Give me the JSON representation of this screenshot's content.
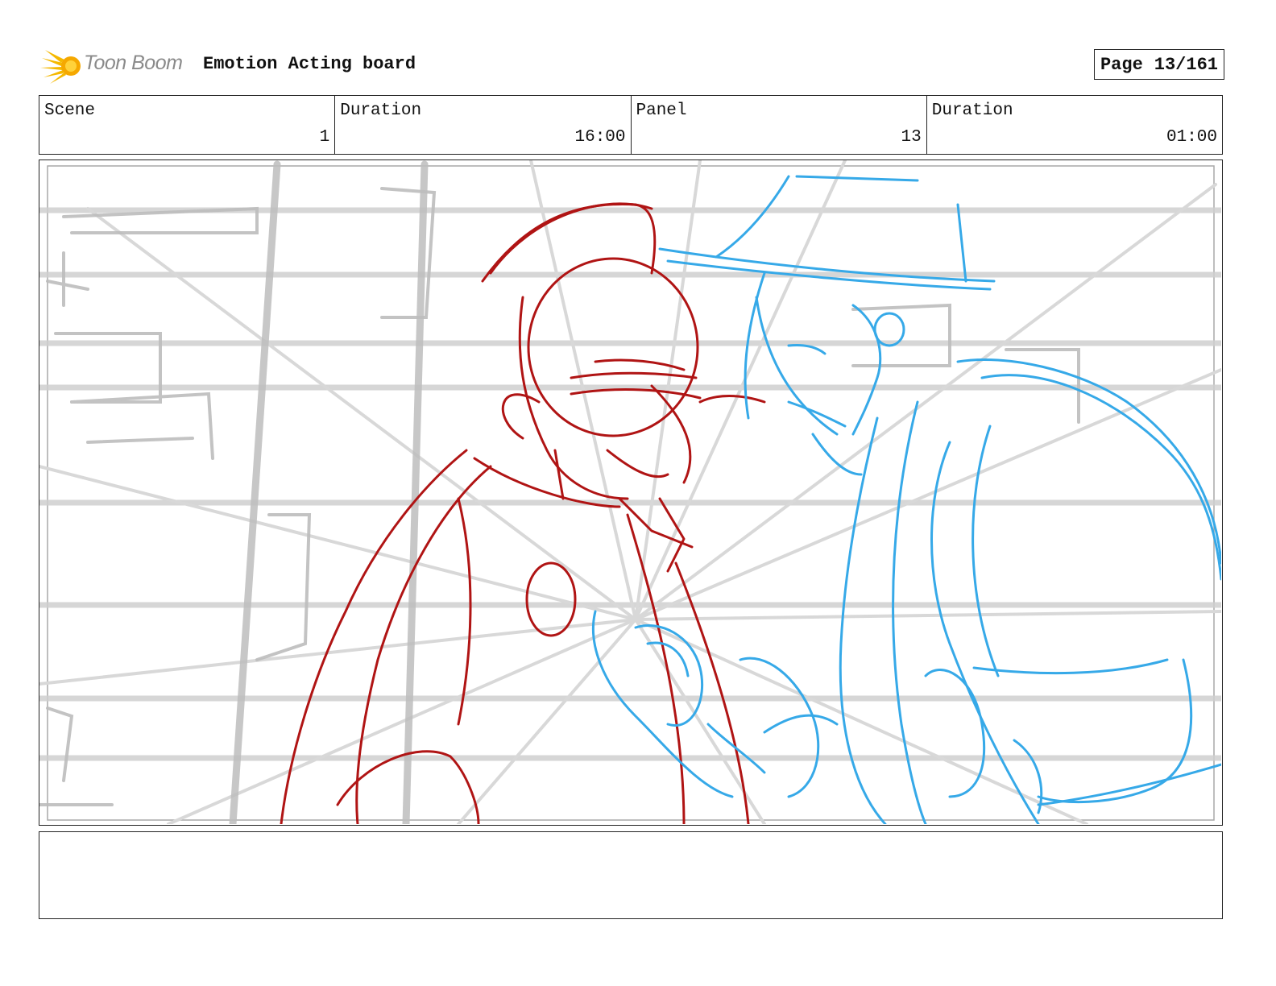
{
  "header": {
    "logo_text": "Toon Boom",
    "board_title": "Emotion Acting board",
    "page_label": "Page",
    "page_number": "13/161"
  },
  "info": {
    "scene_label": "Scene",
    "scene_value": "1",
    "scene_duration_label": "Duration",
    "scene_duration_value": "16:00",
    "panel_label": "Panel",
    "panel_value": "13",
    "panel_duration_label": "Duration",
    "panel_duration_value": "01:00"
  },
  "sketch": {
    "colors": {
      "background_lines": "#c9c9c9",
      "character_left": "#b01414",
      "character_right": "#36a9e8"
    },
    "icons": [
      "toon-boom-logo-icon"
    ]
  }
}
